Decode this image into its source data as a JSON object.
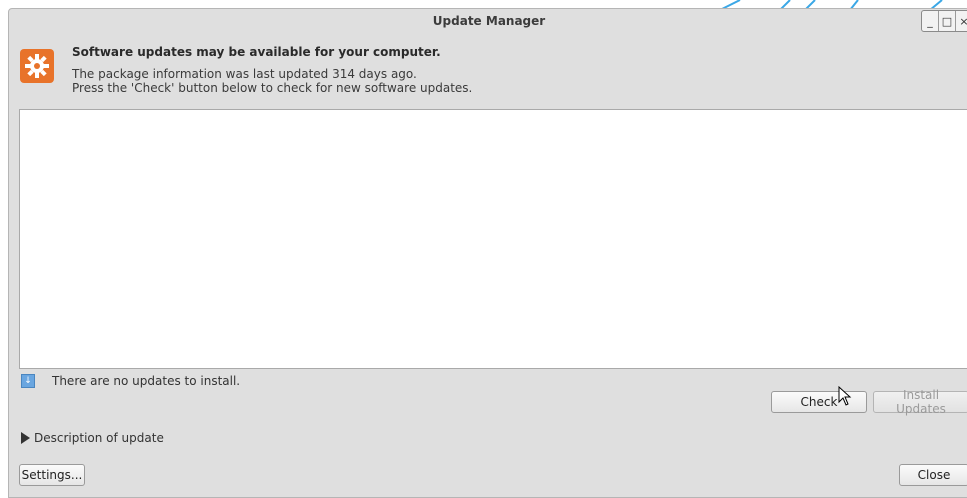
{
  "window": {
    "title": "Update Manager"
  },
  "header": {
    "heading": "Software updates may be available for your computer.",
    "info_line_1": "The package information was last updated 314 days ago.",
    "info_line_2": "Press the 'Check' button below to check for new software updates."
  },
  "status": {
    "text": "There are no updates to install."
  },
  "buttons": {
    "check": "Check",
    "install": "Install Updates",
    "settings": "Settings...",
    "close": "Close"
  },
  "expander": {
    "label": "Description of update"
  },
  "icons": {
    "header": "update-gear-icon",
    "status": "info-down-arrow-icon",
    "expander": "expander-arrow-icon"
  },
  "colors": {
    "header_icon": "#e8732a",
    "status_icon": "#6aa6e0"
  }
}
